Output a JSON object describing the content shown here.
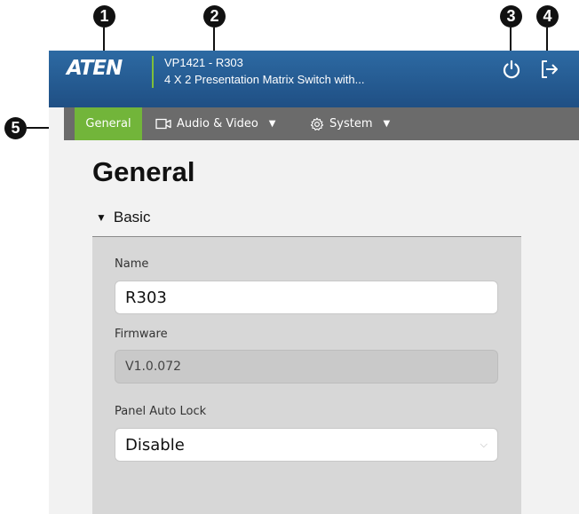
{
  "callouts": [
    "1",
    "2",
    "3",
    "4",
    "5"
  ],
  "header": {
    "logo": "ATEN",
    "device_model": "VP1421 - R303",
    "device_description": "4 X 2 Presentation Matrix Switch with..."
  },
  "nav": {
    "tabs": [
      {
        "label": "General",
        "active": true
      },
      {
        "label": "Audio & Video",
        "active": false
      },
      {
        "label": "System",
        "active": false
      }
    ]
  },
  "page": {
    "title": "General",
    "section": "Basic",
    "fields": {
      "name_label": "Name",
      "name_value": "R303",
      "firmware_label": "Firmware",
      "firmware_value": "V1.0.072",
      "panel_lock_label": "Panel Auto Lock",
      "panel_lock_value": "Disable"
    }
  },
  "colors": {
    "header": "#1f4f84",
    "accent_green": "#72b53a",
    "nav_bg": "#6b6b6b"
  }
}
